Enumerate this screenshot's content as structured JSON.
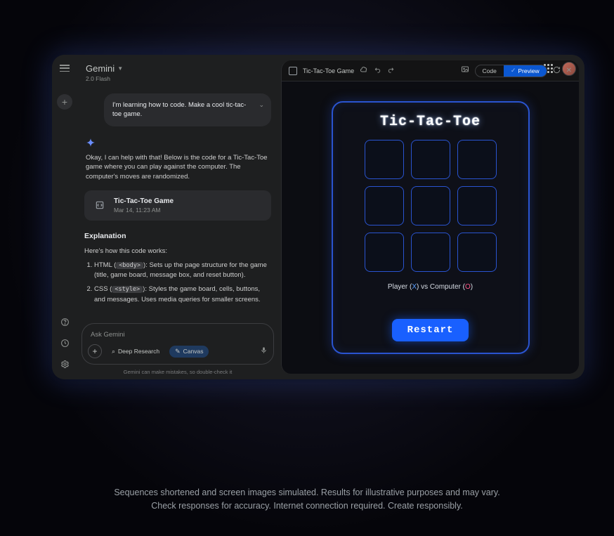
{
  "brand": {
    "name": "Gemini",
    "sub": "2.0 Flash"
  },
  "header": {
    "apps_label": "apps",
    "avatar_label": "avatar"
  },
  "chat": {
    "user_prompt": "I'm learning how to code. Make a cool tic-tac-toe game.",
    "assistant_intro": "Okay, I can help with that! Below is the code for a Tic-Tac-Toe game where you can play against the computer. The computer's moves are randomized.",
    "artifact": {
      "title": "Tic-Tac-Toe Game",
      "timestamp": "Mar 14, 11:23 AM"
    },
    "explanation_heading": "Explanation",
    "explanation_lead": "Here's how this code works:",
    "explanation_items": [
      {
        "prefix": "HTML (",
        "code": "<body>",
        "suffix": "): Sets up the page structure for the game (title, game board, message box, and reset button)."
      },
      {
        "prefix": "CSS (",
        "code": "<style>",
        "suffix": "): Styles the game board, cells, buttons, and messages. Uses media queries for smaller screens."
      }
    ]
  },
  "composer": {
    "placeholder": "Ask Gemini",
    "chips": {
      "deep_research": "Deep Research",
      "canvas": "Canvas"
    },
    "disclaimer": "Gemini can make mistakes, so double-check it"
  },
  "canvas": {
    "title": "Tic-Tac-Toe Game",
    "tabs": {
      "code": "Code",
      "preview": "Preview"
    }
  },
  "game": {
    "title": "Tic-Tac-Toe",
    "status_player": "Player (",
    "status_x": "X",
    "status_mid": ") vs Computer (",
    "status_o": "O",
    "status_end": ")",
    "restart": "Restart"
  },
  "footnote": {
    "line1": "Sequences shortened and screen images simulated. Results for illustrative purposes and may vary.",
    "line2": "Check responses for accuracy. Internet connection required. Create responsibly."
  }
}
